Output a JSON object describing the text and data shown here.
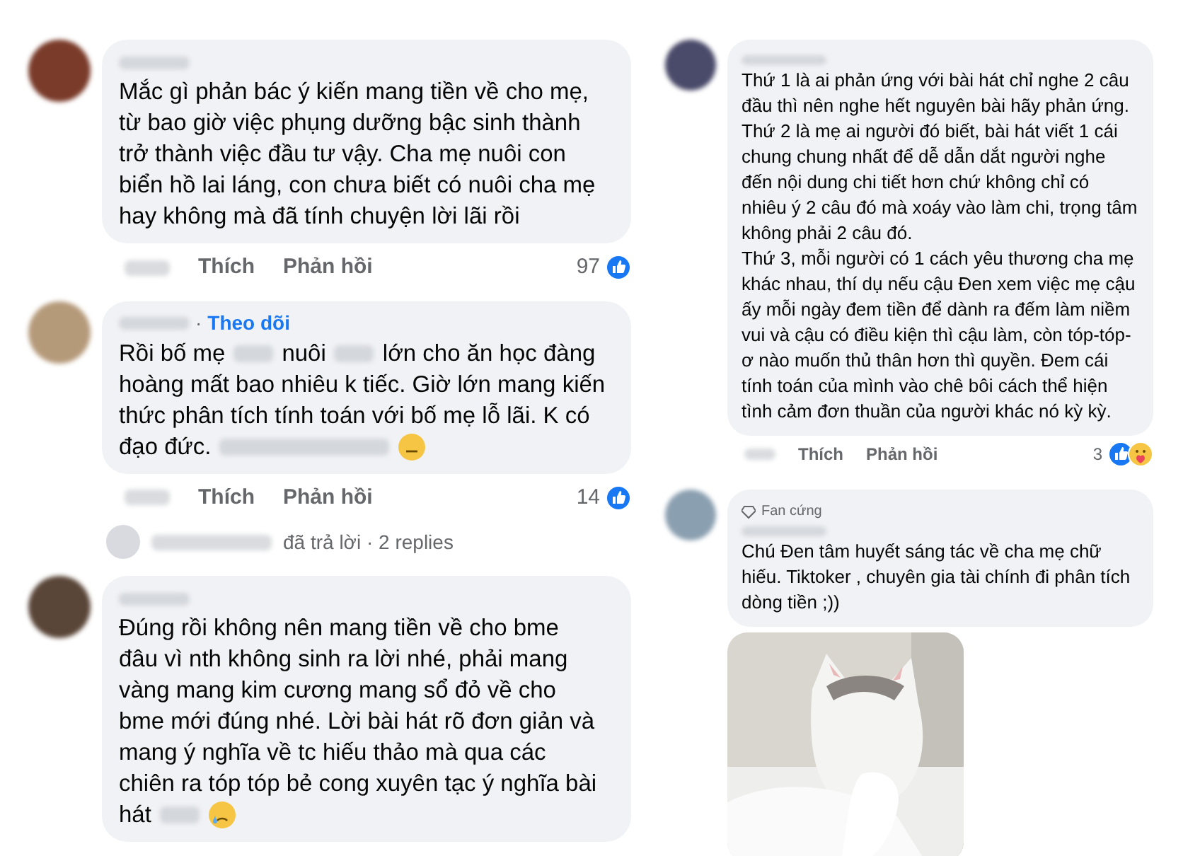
{
  "left_column": [
    {
      "lines": [
        [
          {
            "kind": "text",
            "text": "Mắc gì phản bác ý kiến mang tiền về cho mẹ,"
          }
        ],
        [
          {
            "kind": "text",
            "text": "từ bao giờ việc phụng dưỡng bậc sinh thành"
          }
        ],
        [
          {
            "kind": "text",
            "text": "trở thành việc đầu tư vậy. Cha mẹ nuôi con"
          }
        ],
        [
          {
            "kind": "text",
            "text": "biển hồ lai láng, con chưa biết có nuôi cha mẹ"
          }
        ],
        [
          {
            "kind": "text",
            "text": "hay không mà đã tính chuyện lời lãi rồi"
          }
        ]
      ],
      "actions": [
        "Thích",
        "Phản hồi"
      ],
      "like_count": "97",
      "reactions": [
        {
          "kind": "like"
        }
      ]
    },
    {
      "separator": "·",
      "follow_label": "Theo dõi",
      "lines": [
        [
          {
            "kind": "text",
            "text": "Rồi bố mẹ"
          },
          {
            "kind": "blur"
          },
          {
            "kind": "text",
            "text": "nuôi"
          },
          {
            "kind": "blur"
          },
          {
            "kind": "text",
            "text": "lớn cho ăn học đàng"
          }
        ],
        [
          {
            "kind": "text",
            "text": "hoàng mất bao nhiêu k tiếc. Giờ lớn mang kiến"
          }
        ],
        [
          {
            "kind": "text",
            "text": "thức phân tích tính toán với bố mẹ lỗ lãi. K có"
          }
        ],
        [
          {
            "kind": "text",
            "text": "đạo đức."
          },
          {
            "kind": "blur_long"
          },
          {
            "kind": "annoyed"
          }
        ]
      ],
      "actions": [
        "Thích",
        "Phản hồi"
      ],
      "like_count": "14",
      "reactions": [
        {
          "kind": "like"
        }
      ],
      "replies_text": "đã trả lời · 2 replies"
    },
    {
      "lines": [
        [
          {
            "kind": "text",
            "text": "Đúng rồi không nên mang tiền về cho bme"
          }
        ],
        [
          {
            "kind": "text",
            "text": "đâu vì nth không sinh ra lời nhé, phải mang"
          }
        ],
        [
          {
            "kind": "text",
            "text": "vàng mang kim cương mang sổ đỏ về cho"
          }
        ],
        [
          {
            "kind": "text",
            "text": "bme mới đúng nhé. Lời bài hát rõ đơn giản và"
          }
        ],
        [
          {
            "kind": "text",
            "text": "mang ý nghĩa về tc hiếu thảo mà qua các"
          }
        ],
        [
          {
            "kind": "text",
            "text": "chiên ra tóp tóp bẻ cong xuyên tạc ý nghĩa bài"
          }
        ],
        [
          {
            "kind": "text",
            "text": "hát"
          },
          {
            "kind": "blur"
          },
          {
            "kind": "crying"
          }
        ]
      ]
    }
  ],
  "right_column": [
    {
      "paragraphs": [
        "Thứ 1 là ai phản ứng với bài hát chỉ nghe 2 câu đầu thì nên nghe hết nguyên bài hãy phản ứng.",
        "Thứ 2 là mẹ ai người đó biết, bài hát viết 1 cái chung chung nhất để dễ dẫn dắt người nghe đến nội dung chi tiết hơn chứ không chỉ có nhiêu ý 2 câu đó mà xoáy vào làm chi, trọng tâm không phải 2 câu đó.",
        "Thứ 3, mỗi người có 1 cách yêu thương cha mẹ khác nhau,  thí dụ nếu cậu Đen xem việc mẹ cậu ấy mỗi ngày đem tiền để dành ra đếm làm niềm vui và cậu có điều kiện thì cậu làm, còn tóp-tóp-ơ nào muốn thủ thân hơn thì quyền. Đem cái tính toán của mình vào chê bôi cách thể hiện tình cảm đơn thuần của người khác nó kỳ kỳ."
      ],
      "actions": [
        "Thích",
        "Phản hồi"
      ],
      "like_count": "3",
      "reactions": [
        {
          "kind": "like"
        },
        {
          "kind": "care"
        }
      ]
    },
    {
      "badge": "Fan cứng",
      "paragraphs": [
        "Chú Đen tâm huyết sáng tác về cha mẹ chữ hiếu. Tiktoker , chuyên gia tài chính đi phân tích dòng tiền ;))"
      ],
      "attachment": {
        "kind": "picture"
      }
    }
  ]
}
